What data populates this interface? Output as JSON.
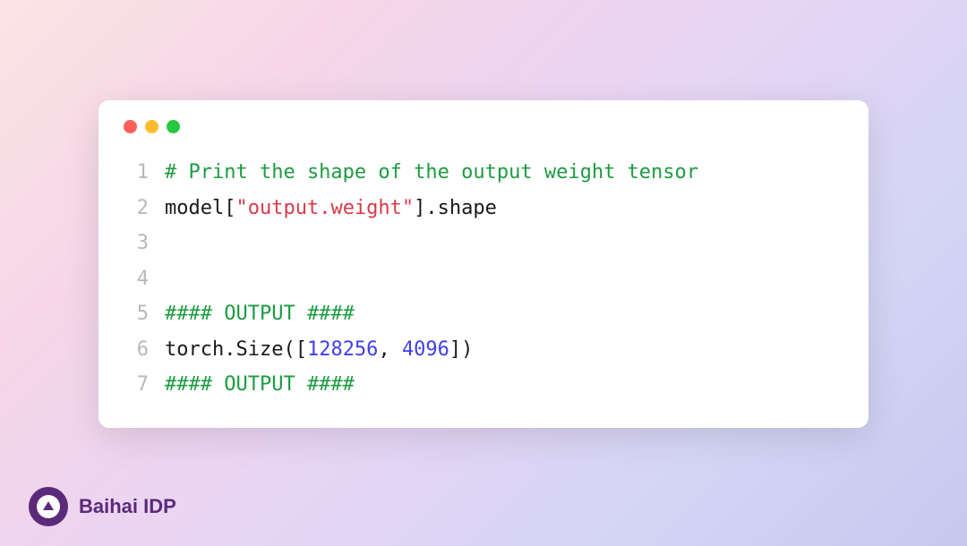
{
  "code": {
    "lines": [
      {
        "number": "1",
        "segments": [
          {
            "type": "comment",
            "text": "# Print the shape of the output weight tensor"
          }
        ]
      },
      {
        "number": "2",
        "segments": [
          {
            "type": "default",
            "text": "model["
          },
          {
            "type": "string",
            "text": "\"output.weight\""
          },
          {
            "type": "default",
            "text": "].shape"
          }
        ]
      },
      {
        "number": "3",
        "segments": []
      },
      {
        "number": "4",
        "segments": []
      },
      {
        "number": "5",
        "segments": [
          {
            "type": "comment",
            "text": "#### OUTPUT ####"
          }
        ]
      },
      {
        "number": "6",
        "segments": [
          {
            "type": "default",
            "text": "torch.Size(["
          },
          {
            "type": "number",
            "text": "128256"
          },
          {
            "type": "default",
            "text": ", "
          },
          {
            "type": "number",
            "text": "4096"
          },
          {
            "type": "default",
            "text": "])"
          }
        ]
      },
      {
        "number": "7",
        "segments": [
          {
            "type": "comment",
            "text": "#### OUTPUT ####"
          }
        ]
      }
    ]
  },
  "logo": {
    "text": "Baihai IDP"
  }
}
